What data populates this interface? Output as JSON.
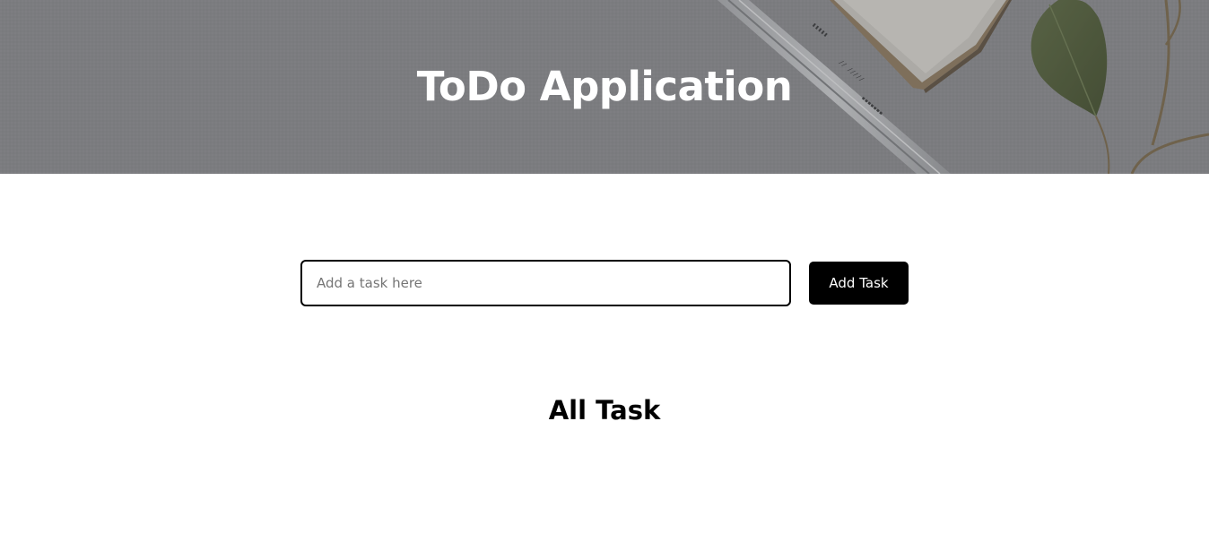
{
  "header": {
    "title": "ToDo Application"
  },
  "task_form": {
    "input_value": "",
    "input_placeholder": "Add a task here",
    "add_button_label": "Add Task"
  },
  "tasks_section": {
    "heading": "All Task",
    "tasks": []
  },
  "colors": {
    "hero_overlay": "#8a8b8e",
    "button_background": "#000000",
    "button_text": "#ffffff",
    "input_border": "#000000"
  },
  "icons": {
    "hero_background": "desk-photo-with-pencil-notebook-and-leaf"
  }
}
